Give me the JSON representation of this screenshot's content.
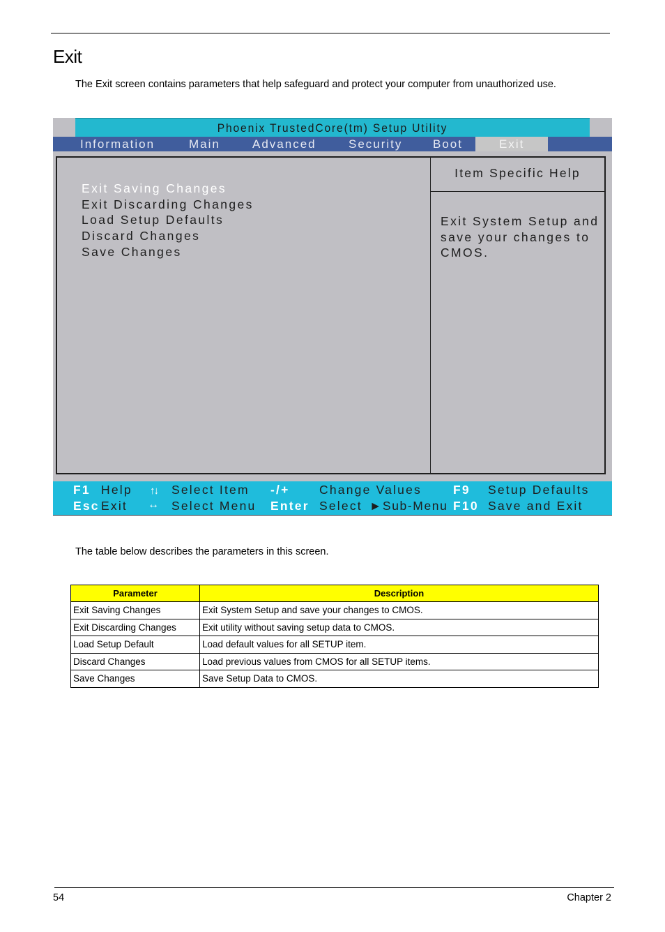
{
  "page": {
    "heading": "Exit",
    "intro": "The Exit screen contains parameters that help safeguard and protect your computer from unauthorized use.",
    "table_intro": "The table below describes the parameters in this screen.",
    "footer": {
      "page_number": "54",
      "chapter": "Chapter 2"
    }
  },
  "bios": {
    "title": "Phoenix TrustedCore(tm) Setup Utility",
    "tabs": [
      {
        "label": "Information",
        "active": false
      },
      {
        "label": "Main",
        "active": false
      },
      {
        "label": "Advanced",
        "active": false
      },
      {
        "label": "Security",
        "active": false
      },
      {
        "label": "Boot",
        "active": false
      },
      {
        "label": "Exit",
        "active": true
      }
    ],
    "menu_items": [
      {
        "label": "Exit Saving Changes",
        "selected": true
      },
      {
        "label": "Exit Discarding Changes",
        "selected": false
      },
      {
        "label": "Load Setup Defaults",
        "selected": false
      },
      {
        "label": "Discard Changes",
        "selected": false
      },
      {
        "label": "Save Changes",
        "selected": false
      }
    ],
    "help": {
      "title": "Item Specific Help",
      "lines": [
        "Exit System Setup and",
        "save your changes to",
        "CMOS."
      ]
    },
    "function_keys": {
      "row1": [
        {
          "key": "F1",
          "action": "Help"
        },
        {
          "key": "↑↓",
          "key_icon": "up-down-arrows",
          "action": "Select Item"
        },
        {
          "key": "-/+",
          "action": "Change Values"
        },
        {
          "key": "F9",
          "action": "Setup Defaults"
        }
      ],
      "row2": [
        {
          "key": "Esc",
          "action": "Exit"
        },
        {
          "key": "↔",
          "key_icon": "left-right-arrow",
          "action": "Select Menu"
        },
        {
          "key": "Enter",
          "action": "Select",
          "action_suffix_icon": "right-triangle",
          "action_suffix": "►Sub-Menu"
        },
        {
          "key": "F10",
          "action": "Save and Exit"
        }
      ]
    },
    "colors": {
      "title_bar": "#23b8cf",
      "menu_bar": "#405d9d",
      "active_tab": "#c6c6c6",
      "body": "#c0bfc4",
      "footer": "#1fbcdc"
    }
  },
  "table": {
    "headers": [
      "Parameter",
      "Description"
    ],
    "header_color": "#ffff00",
    "rows": [
      [
        "Exit Saving Changes",
        "Exit System Setup and save your changes to CMOS."
      ],
      [
        "Exit Discarding Changes",
        "Exit utility without saving setup data to CMOS."
      ],
      [
        "Load Setup Default",
        "Load default values for all SETUP item."
      ],
      [
        "Discard Changes",
        "Load previous values from CMOS for all SETUP items."
      ],
      [
        "Save Changes",
        "Save Setup Data to CMOS."
      ]
    ]
  }
}
